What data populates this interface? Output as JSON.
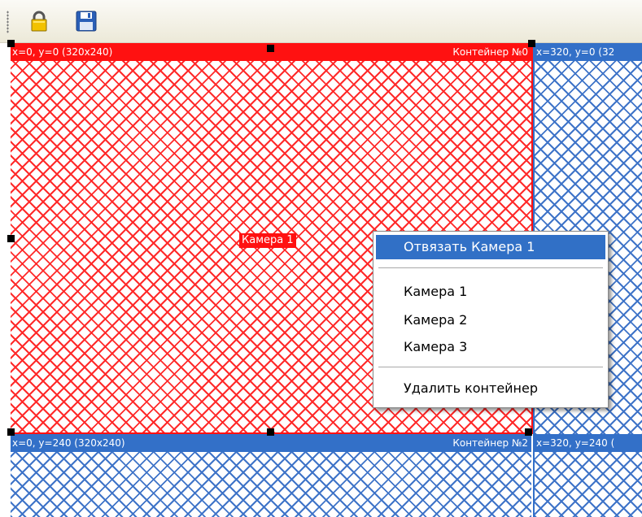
{
  "toolbar": {
    "lock_icon": "lock-icon",
    "save_icon": "floppy-save-icon"
  },
  "containers": [
    {
      "coords": "x=0, y=0 (320x240)",
      "name": "Контейнер №0",
      "color": "#ff1111"
    },
    {
      "coords": "x=320, y=0 (32",
      "name": "",
      "color": "#3370c8"
    },
    {
      "coords": "x=0, y=240 (320x240)",
      "name": "Контейнер №2",
      "color": "#3370c8"
    },
    {
      "coords": "x=320, y=240 (",
      "name": "",
      "color": "#3370c8"
    }
  ],
  "camera_label": "Камера 1",
  "context_menu": {
    "unbind": "Отвязать Камера 1",
    "cameras": [
      "Камера 1",
      "Камера 2",
      "Камера 3"
    ],
    "delete": "Удалить контейнер"
  },
  "colors": {
    "selected": "#ff1111",
    "normal": "#3370c8",
    "menu_highlight": "#3170c6"
  }
}
